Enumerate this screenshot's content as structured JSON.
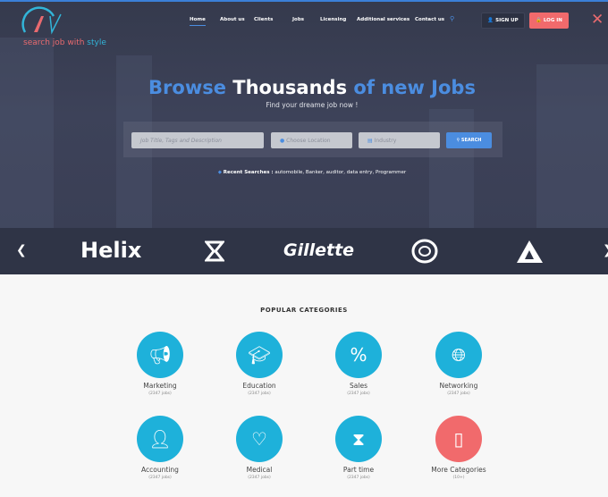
{
  "header": {
    "tagline_a": "search job with ",
    "tagline_b": "style",
    "logo_text": "Jw",
    "nav": [
      "Home",
      "About us",
      "Clients",
      "Jobs",
      "Licensing",
      "Additional services",
      "Contact us"
    ],
    "signup": "SIGN UP",
    "login": "LOG IN"
  },
  "hero": {
    "title_a": "Browse ",
    "title_b": "Thousands",
    "title_c": " of new Jobs",
    "subtitle": "Find your dreame job now !",
    "search": {
      "keyword_placeholder": "Job Title, Tags and Description",
      "location_placeholder": "Choose Location",
      "industry_placeholder": "Industry",
      "button": "SEARCH"
    },
    "recent_label": "Recent Searches :",
    "recent": "automobile,  Banker,  auditor, data entry,  Programmer"
  },
  "brands": [
    "Helix",
    "Gillette"
  ],
  "categories": {
    "title": "POPULAR CATEGORIES",
    "items": [
      {
        "name": "Marketing",
        "count": "(2347 jobs)",
        "icon": "megaphone-icon"
      },
      {
        "name": "Education",
        "count": "(2347 jobs)",
        "icon": "graduation-cap-icon"
      },
      {
        "name": "Sales",
        "count": "(2347 jobs)",
        "icon": "hand-percent-icon"
      },
      {
        "name": "Networking",
        "count": "(2347 jobs)",
        "icon": "globe-network-icon"
      },
      {
        "name": "Accounting",
        "count": "(2347 jobs)",
        "icon": "accountant-icon"
      },
      {
        "name": "Medical",
        "count": "(2347 jobs)",
        "icon": "heart-hand-icon"
      },
      {
        "name": "Part time",
        "count": "(2347 jobs)",
        "icon": "hourglass-icon"
      },
      {
        "name": "More Categories",
        "count": "(10+)",
        "icon": "more-icon"
      }
    ]
  },
  "colors": {
    "accent": "#4b8de0",
    "category": "#1eb1da",
    "login": "#f16a6c"
  }
}
